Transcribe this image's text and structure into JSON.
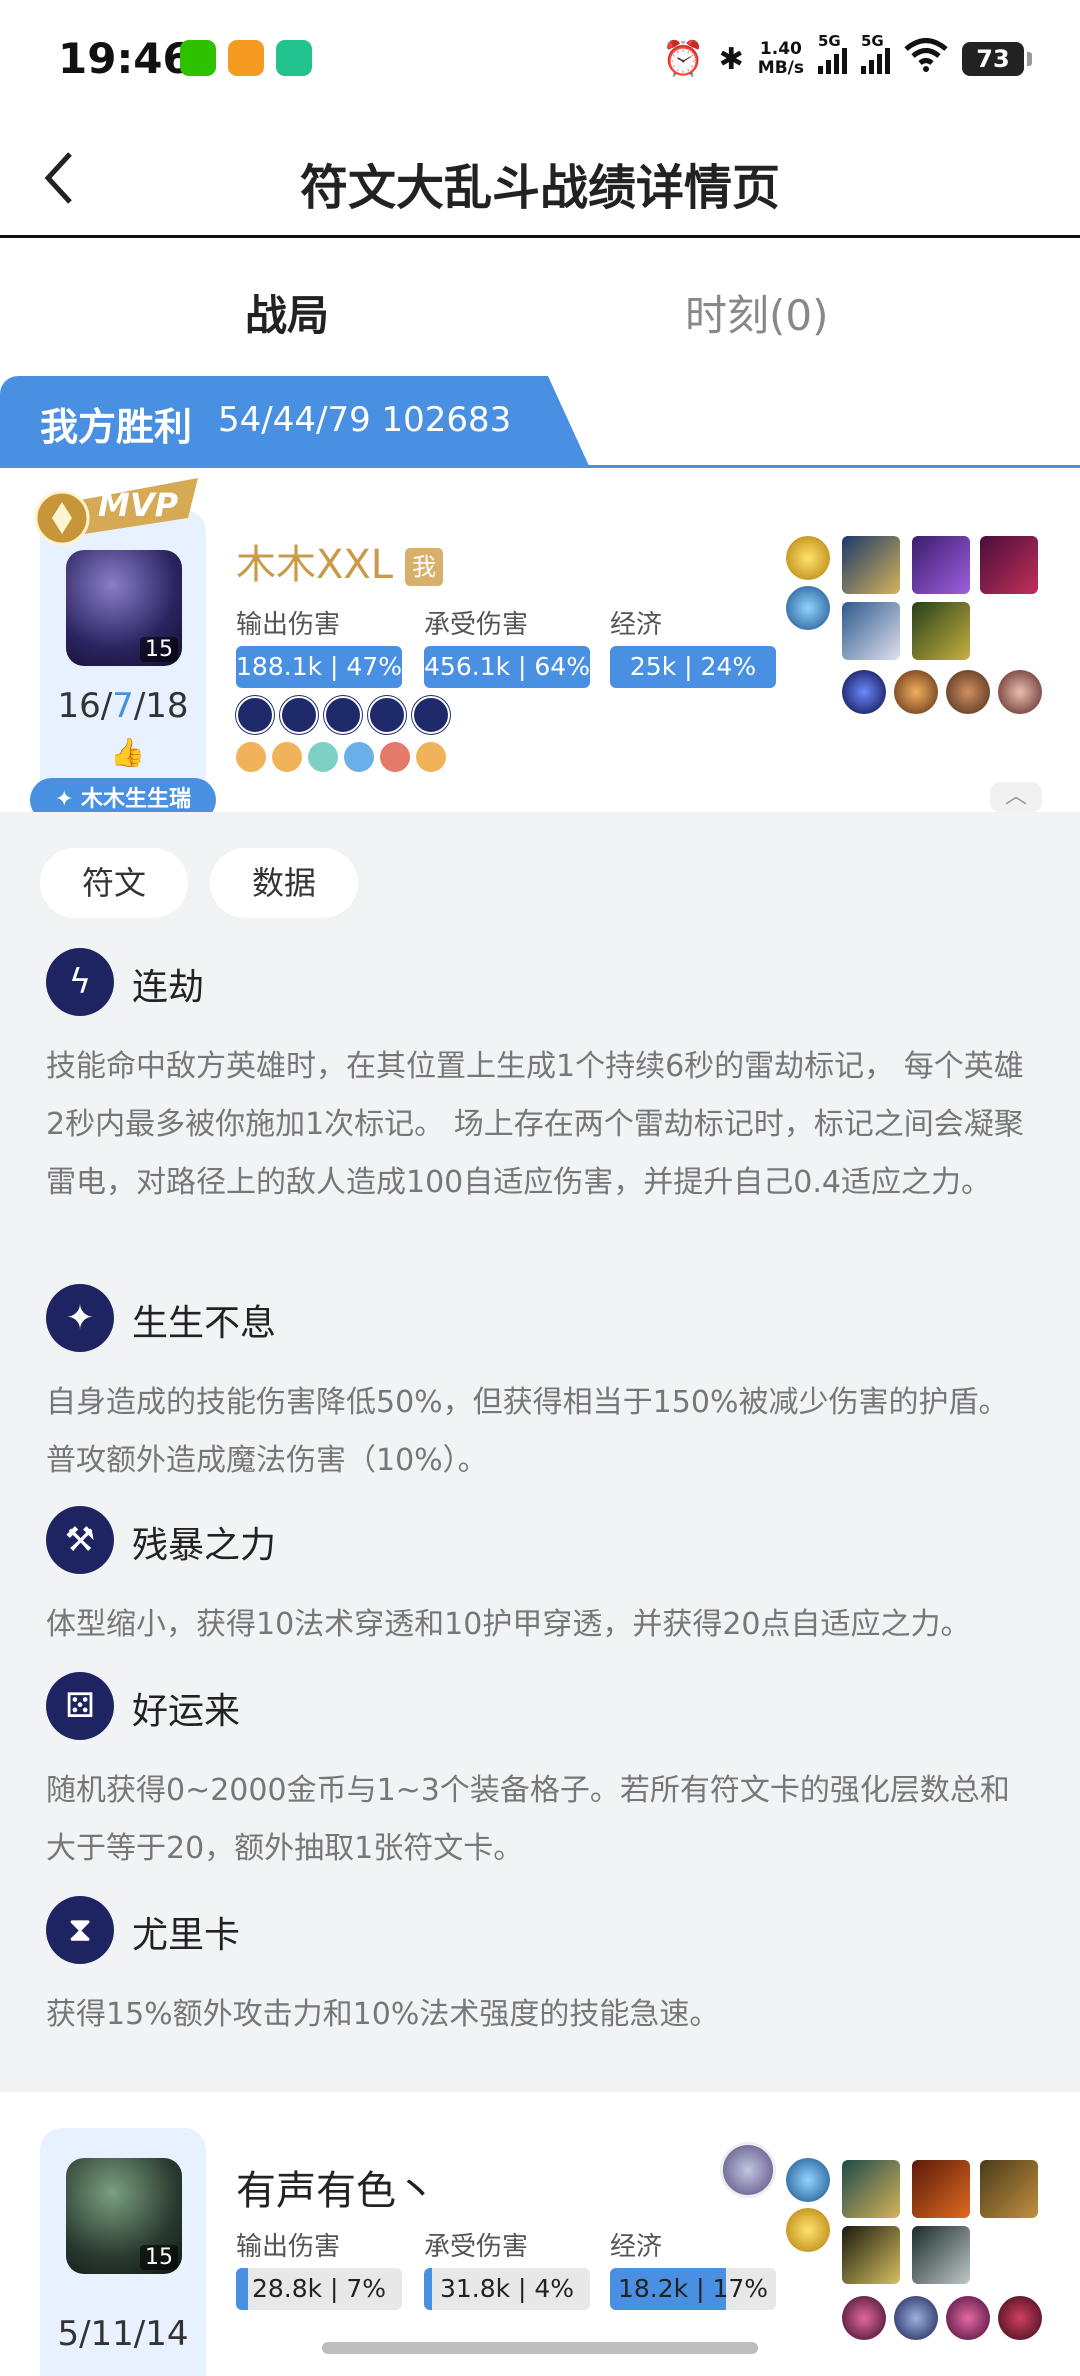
{
  "status_bar": {
    "time": "19:46",
    "net_speed_value": "1.40",
    "net_speed_unit": "MB/s",
    "signal_1": "5G",
    "signal_2": "5G",
    "battery": "73",
    "icons": [
      "wechat-icon",
      "app-icon",
      "app-icon",
      "alarm-icon",
      "bluetooth-icon",
      "wifi-icon"
    ]
  },
  "header": {
    "back_icon": "chevron-left-icon",
    "title": "符文大乱斗战绩详情页"
  },
  "tabs": [
    {
      "label": "战局",
      "active": true
    },
    {
      "label": "时刻(0)",
      "active": false
    }
  ],
  "result": {
    "label": "我方胜利",
    "stats": "54/44/79  102683"
  },
  "player1": {
    "mvp": "MVP",
    "level": "15",
    "kda_k": "16/",
    "kda_d": "7",
    "kda_a": "/18",
    "name": "木木XXL",
    "me_badge": "我",
    "title_badge": "✦ 木木生生瑞",
    "damage_label": "输出伤害",
    "damage_value": "188.1k | 47%",
    "damage_fraction": 1.0,
    "taken_label": "承受伤害",
    "taken_value": "456.1k | 64%",
    "taken_fraction": 1.0,
    "gold_label": "经济",
    "gold_value": "25k | 24%",
    "gold_fraction": 1.0
  },
  "detail_tabs": {
    "runes": "符文",
    "data": "数据"
  },
  "runes": [
    {
      "name": "连劫",
      "icon": "lightning-rune-icon",
      "desc": "技能命中敌方英雄时，在其位置上生成1个持续6秒的雷劫标记， 每个英雄2秒内最多被你施加1次标记。 场上存在两个雷劫标记时，标记之间会凝聚雷电，对路径上的敌人造成100自适应伤害，并提升自己0.4适应之力。"
    },
    {
      "name": "生生不息",
      "icon": "star-rune-icon",
      "desc": "自身造成的技能伤害降低50%，但获得相当于150%被减少伤害的护盾。普攻额外造成魔法伤害（10%）。"
    },
    {
      "name": "残暴之力",
      "icon": "hammer-rune-icon",
      "desc": "体型缩小，获得10法术穿透和10护甲穿透，并获得20点自适应之力。"
    },
    {
      "name": "好运来",
      "icon": "dice-rune-icon",
      "desc": "随机获得0~2000金币与1~3个装备格子。若所有符文卡的强化层数总和大于等于20，额外抽取1张符文卡。"
    },
    {
      "name": "尤里卡",
      "icon": "hourglass-rune-icon",
      "desc": "获得15%额外攻击力和10%法术强度的技能急速。"
    }
  ],
  "player2": {
    "level": "15",
    "kda": "5/11/14",
    "name": "有声有色丶",
    "damage_label": "输出伤害",
    "damage_value": "28.8k | 7%",
    "damage_fraction": 0.07,
    "taken_label": "承受伤害",
    "taken_value": "31.8k | 4%",
    "taken_fraction": 0.04,
    "gold_label": "经济",
    "gold_value": "18.2k | 17%",
    "gold_fraction": 0.7
  },
  "colors": {
    "accent": "#4a90e2",
    "gold": "#c89a4a",
    "panel_bg": "#f2f3f5",
    "rune_bg": "#1e2461"
  }
}
